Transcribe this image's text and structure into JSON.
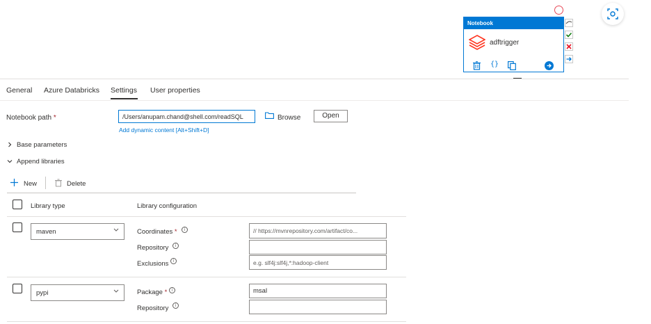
{
  "node": {
    "header": "Notebook",
    "title": "adftrigger"
  },
  "tabs": [
    {
      "label": "General"
    },
    {
      "label": "Azure Databricks"
    },
    {
      "label": "Settings"
    },
    {
      "label": "User properties"
    }
  ],
  "settings": {
    "notebook_path_label": "Notebook path",
    "required_mark": "*",
    "notebook_path_value": "/Users/anupam.chand@shell.com/readSQL",
    "browse_label": "Browse",
    "open_label": "Open",
    "dynamic_content_link": "Add dynamic content [Alt+Shift+D]",
    "base_parameters_label": "Base parameters",
    "append_libraries_label": "Append libraries"
  },
  "toolbar": {
    "new_label": "New",
    "delete_label": "Delete"
  },
  "table": {
    "headers": [
      "Library type",
      "Library configuration"
    ],
    "rows": [
      {
        "type": "maven",
        "fields": [
          {
            "label": "Coordinates",
            "required": true,
            "value": "",
            "placeholder": "// https://mvnrepository.com/artifact/co..."
          },
          {
            "label": "Repository",
            "required": false,
            "value": "",
            "placeholder": ""
          },
          {
            "label": "Exclusions",
            "required": false,
            "value": "",
            "placeholder": "e.g. slf4j:slf4j,*:hadoop-client"
          }
        ]
      },
      {
        "type": "pypi",
        "fields": [
          {
            "label": "Package",
            "required": true,
            "value": "msal",
            "placeholder": ""
          },
          {
            "label": "Repository",
            "required": false,
            "value": "",
            "placeholder": ""
          }
        ]
      }
    ]
  },
  "colors": {
    "accent": "#0078d4",
    "required": "#a4262c",
    "status_success": "#107c10",
    "status_fail": "#e81123",
    "databricks_logo": "#ff3621"
  },
  "icons": {
    "info": "i"
  }
}
